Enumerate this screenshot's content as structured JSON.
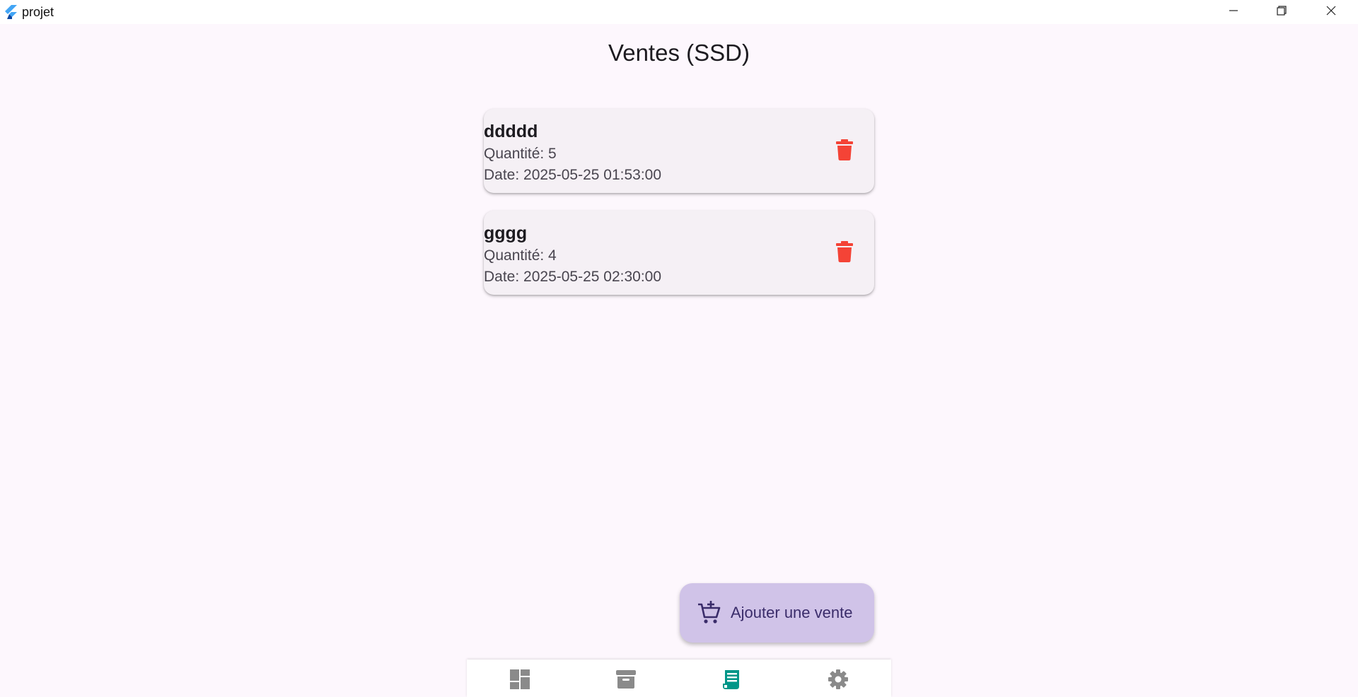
{
  "window": {
    "title": "projet",
    "app_icon": "flutter-logo-icon",
    "controls": [
      "minimize-icon",
      "restore-icon",
      "close-icon"
    ]
  },
  "page": {
    "title": "Ventes (SSD)"
  },
  "sales": [
    {
      "name": "ddddd",
      "quantity_text": "Quantité: 5",
      "date_text": "Date: 2025-05-25 01:53:00",
      "action_icon": "trash-icon"
    },
    {
      "name": "gggg",
      "quantity_text": "Quantité: 4",
      "date_text": "Date: 2025-05-25 02:30:00",
      "action_icon": "trash-icon"
    }
  ],
  "fab": {
    "label": "Ajouter une vente",
    "icon": "add-to-cart-icon"
  },
  "bottom_nav": {
    "items": [
      {
        "icon": "dashboard-icon",
        "selected": false
      },
      {
        "icon": "inventory-archive-icon",
        "selected": false
      },
      {
        "icon": "receipt-icon",
        "selected": true
      },
      {
        "icon": "settings-gear-icon",
        "selected": false
      }
    ]
  },
  "colors": {
    "background": "#fdf7fd",
    "card": "#f5f0f5",
    "delete": "#f44336",
    "fab_bg": "#d0c3e8",
    "fab_text": "#3a2c6a",
    "nav_active": "#009688",
    "nav_inactive": "#8a8a8a"
  }
}
